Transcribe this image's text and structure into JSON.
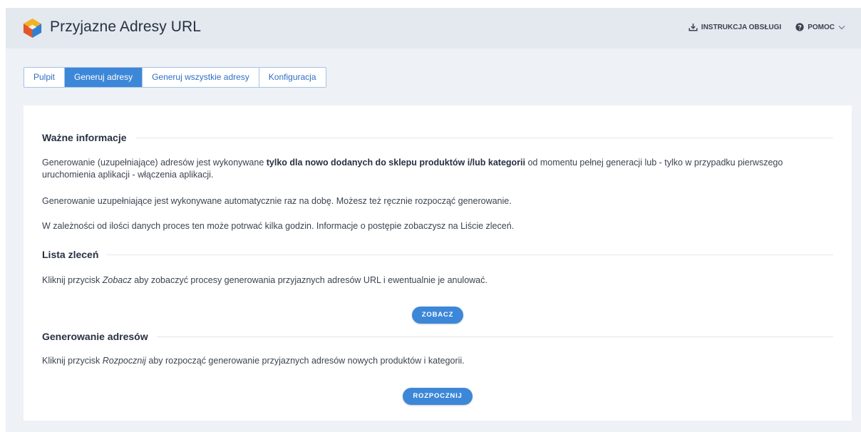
{
  "header": {
    "title": "Przyjazne Adresy URL",
    "manual_label": "INSTRUKCJA OBSŁUGI",
    "help_label": "POMOC",
    "manual_icon": "download-icon",
    "help_icon": "question-circle-icon",
    "help_chevron": "chevron-down-icon"
  },
  "tabs": [
    {
      "label": "Pulpit",
      "active": false
    },
    {
      "label": "Generuj adresy",
      "active": true
    },
    {
      "label": "Generuj wszystkie adresy",
      "active": false
    },
    {
      "label": "Konfiguracja",
      "active": false
    }
  ],
  "sections": {
    "info": {
      "title": "Ważne informacje",
      "p1_before": "Generowanie (uzupełniające) adresów jest wykonywane ",
      "p1_bold": "tylko dla nowo dodanych do sklepu produktów i/lub kategorii",
      "p1_after": " od momentu pełnej generacji lub - tylko w przypadku pierwszego uruchomienia aplikacji - włączenia aplikacji.",
      "p2": "Generowanie uzupełniające jest wykonywane automatycznie raz na dobę. Możesz też ręcznie rozpocząć generowanie.",
      "p3": "W zależności od ilości danych proces ten może potrwać kilka godzin. Informacje o postępie zobaczysz na Liście zleceń."
    },
    "orders": {
      "title": "Lista zleceń",
      "text_before": "Kliknij przycisk ",
      "text_italic": "Zobacz",
      "text_after": " aby zobaczyć procesy generowania przyjaznych adresów URL i ewentualnie je anulować.",
      "button": "ZOBACZ"
    },
    "generate": {
      "title": "Generowanie adresów",
      "text_before": "Kliknij przycisk ",
      "text_italic": "Rozpocznij",
      "text_after": " aby rozpocząć generowanie przyjaznych adresów nowych produktów i kategorii.",
      "button": "ROZPOCZNIJ"
    }
  },
  "colors": {
    "accent": "#3d87d8",
    "header_bg": "#e4e8ef",
    "page_bg": "#eef1f6"
  }
}
